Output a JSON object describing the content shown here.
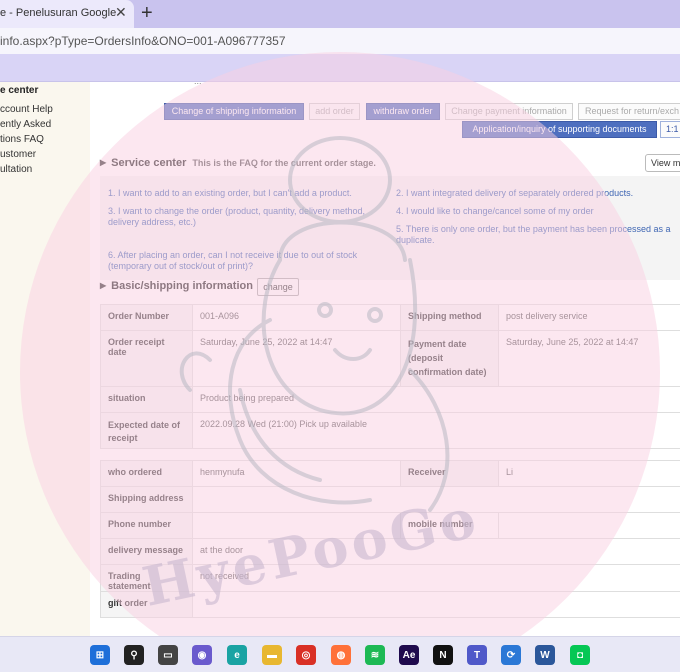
{
  "browser": {
    "tab_title": "e - Penelusuran Google",
    "tab_close": "✕",
    "new_tab": "+",
    "url": "info.aspx?pType=OrdersInfo&ONO=001-A096777357"
  },
  "sidebar": {
    "title": "e center",
    "items": [
      "ccount Help",
      "ently Asked",
      "tions FAQ",
      "ustomer",
      "ultation"
    ]
  },
  "top_cut_text": "...",
  "action_buttons": {
    "change_shipping": "Change of shipping information",
    "add_order": "add order",
    "withdraw_order": "withdraw order",
    "change_payment": "Change payment information",
    "request_return": "Request for return/exch",
    "supporting_docs": "Application/inquiry of supporting documents",
    "one_to_one": "1:1"
  },
  "service_center": {
    "title": "Service center",
    "subtitle": "This is the FAQ for the current order stage.",
    "view_more": "View m",
    "faqs": [
      "1. I want to add to an existing order, but I can't add a product.",
      "2. I want integrated delivery of separately ordered products.",
      "3. I want to change the order (product, quantity, delivery method, delivery address, etc.)",
      "4. I would like to change/cancel some of my order",
      "5. There is only one order, but the payment has been processed as a duplicate.",
      "6. After placing an order, can I not receive it due to out of stock (temporary out of stock/out of print)?"
    ]
  },
  "basic_info": {
    "title": "Basic/shipping information",
    "change_label": "change",
    "order_number_label": "Order Number",
    "order_number": "001-A096",
    "shipping_method_label": "Shipping method",
    "shipping_method": "post delivery service",
    "receipt_date_label": "Order receipt date",
    "receipt_date": "Saturday, June 25, 2022 at 14:47",
    "payment_date_label": "Payment date (deposit confirmation date)",
    "payment_date": "Saturday, June 25, 2022 at 14:47",
    "situation_label": "situation",
    "situation": "Product being prepared",
    "expected_label": "Expected date of receipt",
    "expected": "2022.09.28 Wed (21:00) Pick up available"
  },
  "shipping_info": {
    "who_ordered_label": "who ordered",
    "who_ordered": "henmynufa",
    "receiver_label": "Receiver",
    "receiver": "Li",
    "address_label": "Shipping address",
    "address": "",
    "phone_label": "Phone number",
    "phone": "",
    "mobile_label": "mobile number",
    "mobile": "",
    "delivery_msg_label": "delivery message",
    "delivery_msg": "at the door",
    "trading_label": "Trading statement",
    "trading": "not received",
    "gift_label": "gift order",
    "gift": ""
  },
  "watermark": {
    "text": "HyePooGo",
    "color": "#f4a7c8"
  },
  "taskbar": {
    "icons": [
      {
        "name": "windows-start-icon",
        "glyph": "⊞",
        "color": "#1e6fd9"
      },
      {
        "name": "search-icon",
        "glyph": "⚲",
        "color": "#222222"
      },
      {
        "name": "task-view-icon",
        "glyph": "▭",
        "color": "#444444"
      },
      {
        "name": "chat-icon",
        "glyph": "◉",
        "color": "#6a5acd"
      },
      {
        "name": "edge-icon",
        "glyph": "e",
        "color": "#1aa3a3"
      },
      {
        "name": "file-explorer-icon",
        "glyph": "▬",
        "color": "#e8b730"
      },
      {
        "name": "chrome-icon",
        "glyph": "◎",
        "color": "#d93025"
      },
      {
        "name": "firefox-icon",
        "glyph": "◍",
        "color": "#ff7139"
      },
      {
        "name": "spotify-icon",
        "glyph": "≋",
        "color": "#1db954"
      },
      {
        "name": "after-effects-icon",
        "glyph": "Ae",
        "color": "#1f0a4d"
      },
      {
        "name": "notion-icon",
        "glyph": "N",
        "color": "#111111"
      },
      {
        "name": "teams-icon",
        "glyph": "T",
        "color": "#5059c9"
      },
      {
        "name": "sync-icon",
        "glyph": "⟳",
        "color": "#2b78d6"
      },
      {
        "name": "word-icon",
        "glyph": "W",
        "color": "#2b579a"
      },
      {
        "name": "line-icon",
        "glyph": "◘",
        "color": "#06c755"
      }
    ]
  }
}
